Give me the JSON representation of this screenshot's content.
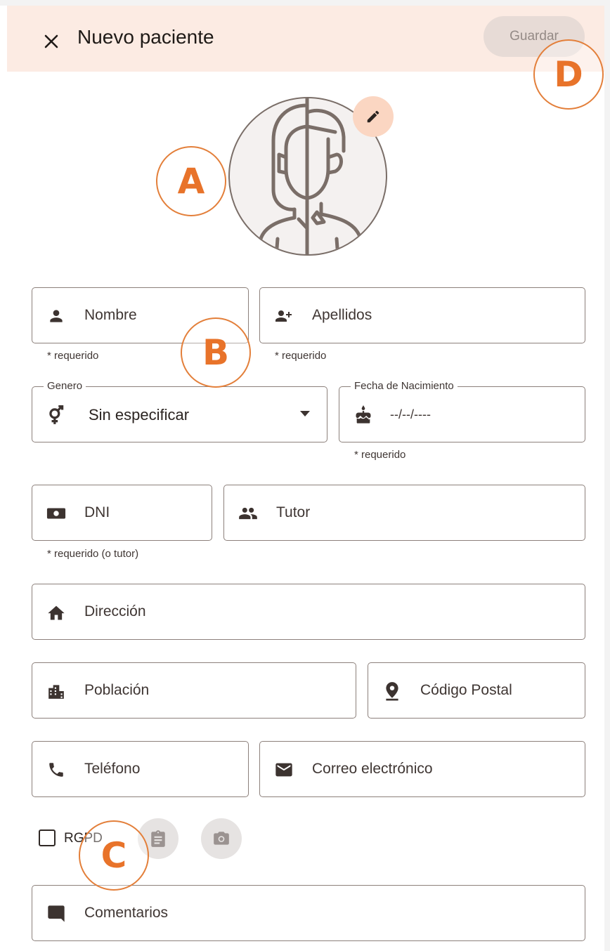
{
  "header": {
    "title": "Nuevo paciente",
    "save_label": "Guardar"
  },
  "form": {
    "nombre": {
      "label": "Nombre",
      "helper": "* requerido"
    },
    "apellidos": {
      "label": "Apellidos",
      "helper": "* requerido"
    },
    "genero": {
      "legend": "Genero",
      "value": "Sin especificar"
    },
    "fecha": {
      "legend": "Fecha de Nacimiento",
      "value": "--/--/----",
      "helper": "* requerido"
    },
    "dni": {
      "label": "DNI",
      "helper": "* requerido (o tutor)"
    },
    "tutor": {
      "label": "Tutor"
    },
    "direccion": {
      "label": "Dirección"
    },
    "poblacion": {
      "label": "Población"
    },
    "codigo_postal": {
      "label": "Código Postal"
    },
    "telefono": {
      "label": "Teléfono"
    },
    "correo": {
      "label": "Correo electrónico"
    },
    "rgpd": {
      "label": "RGPD",
      "checked": false
    },
    "comentarios": {
      "label": "Comentarios"
    }
  },
  "markers": {
    "a": "A",
    "b": "B",
    "c": "C",
    "d": "D"
  },
  "icons": {
    "close": "close-icon",
    "edit": "pencil-icon",
    "person": "person-icon",
    "person_add": "person-add-icon",
    "gender": "gender-icon",
    "cake": "cake-icon",
    "id_card": "id-card-icon",
    "group": "group-icon",
    "home": "home-icon",
    "city": "city-icon",
    "location": "location-pin-icon",
    "phone": "phone-icon",
    "email": "email-icon",
    "clipboard": "clipboard-icon",
    "camera": "camera-icon",
    "comment": "comment-icon"
  },
  "colors": {
    "appbar_bg": "#fcebe3",
    "accent": "#e8732a",
    "border": "#8c807b",
    "icon": "#3c3330"
  }
}
